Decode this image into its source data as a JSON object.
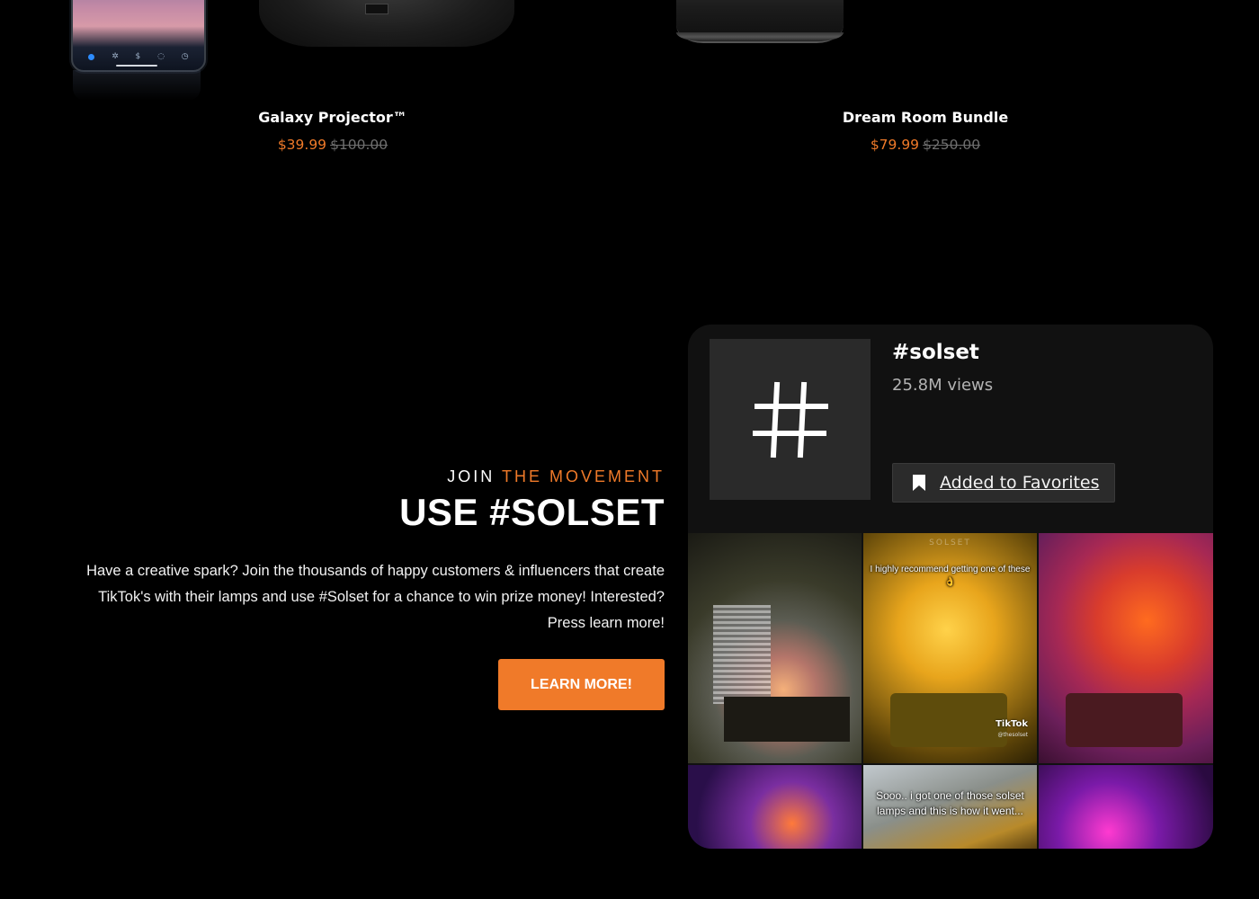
{
  "products": [
    {
      "title": "Galaxy Projector™",
      "sale_price": "$39.99",
      "original_price": "$100.00"
    },
    {
      "title": "Dream Room Bundle",
      "sale_price": "$79.99",
      "original_price": "$250.00"
    }
  ],
  "movement": {
    "eyebrow_plain": "JOIN ",
    "eyebrow_accent": "THE MOVEMENT",
    "headline": "USE #SOLSET",
    "body": "Have a creative spark? Join the thousands of happy customers & influencers that create TikTok's with their lamps and use #Solset for a chance to win prize money! Interested? Press learn more!",
    "cta_label": "LEARN MORE!"
  },
  "tiktok_card": {
    "hashtag": "#solset",
    "views": "25.8M views",
    "favorite_label": "Added to Favorites",
    "tiles": [
      {
        "overlay": ""
      },
      {
        "brand": "SOLSET",
        "overlay": "I highly recommend getting one of these 👌",
        "platform": "TikTok",
        "handle": "@thesolset"
      },
      {
        "overlay": ""
      },
      {
        "overlay": ""
      },
      {
        "overlay": "Sooo.. i got one of those solset lamps and this is how it went..."
      },
      {
        "overlay": ""
      }
    ]
  },
  "colors": {
    "accent": "#f07a29",
    "background": "#000000",
    "card": "#111111"
  },
  "icons": {
    "hashtag": "hashtag-icon",
    "bookmark": "bookmark-icon"
  }
}
